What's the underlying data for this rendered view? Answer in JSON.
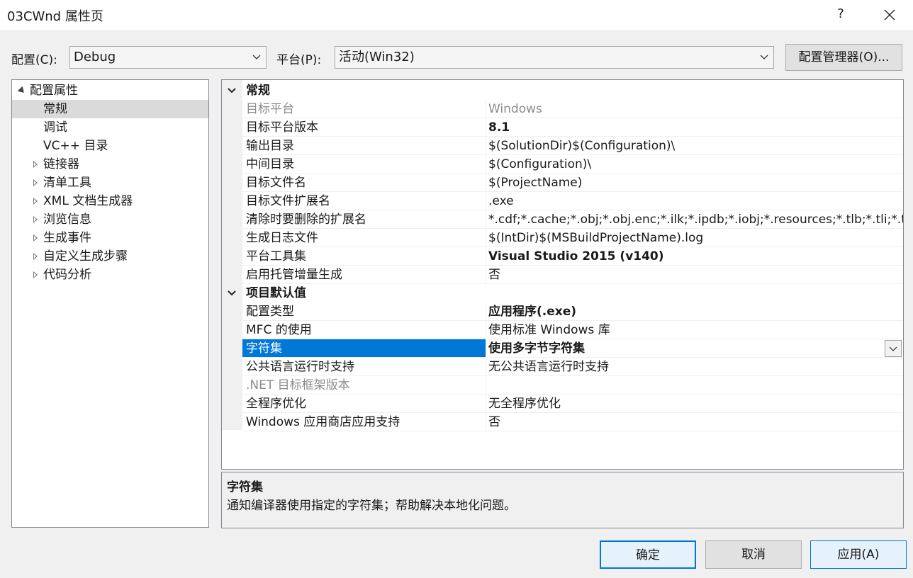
{
  "window": {
    "title": "03CWnd 属性页",
    "help_label": "?"
  },
  "toolbar": {
    "config_label": "配置(C):",
    "config_value": "Debug",
    "platform_label": "平台(P):",
    "platform_value": "活动(Win32)",
    "config_manager_label": "配置管理器(O)..."
  },
  "tree": {
    "root": "配置属性",
    "items": [
      {
        "label": "常规",
        "expandable": false,
        "selected": true
      },
      {
        "label": "调试",
        "expandable": false,
        "selected": false
      },
      {
        "label": "VC++ 目录",
        "expandable": false,
        "selected": false
      },
      {
        "label": "链接器",
        "expandable": true,
        "selected": false
      },
      {
        "label": "清单工具",
        "expandable": true,
        "selected": false
      },
      {
        "label": "XML 文档生成器",
        "expandable": true,
        "selected": false
      },
      {
        "label": "浏览信息",
        "expandable": true,
        "selected": false
      },
      {
        "label": "生成事件",
        "expandable": true,
        "selected": false
      },
      {
        "label": "自定义生成步骤",
        "expandable": true,
        "selected": false
      },
      {
        "label": "代码分析",
        "expandable": true,
        "selected": false
      }
    ]
  },
  "grid": {
    "sections": [
      {
        "title": "常规",
        "rows": [
          {
            "name": "目标平台",
            "value": "Windows",
            "disabled": true,
            "bold": false
          },
          {
            "name": "目标平台版本",
            "value": "8.1",
            "disabled": false,
            "bold": true
          },
          {
            "name": "输出目录",
            "value": "$(SolutionDir)$(Configuration)\\",
            "disabled": false,
            "bold": false
          },
          {
            "name": "中间目录",
            "value": "$(Configuration)\\",
            "disabled": false,
            "bold": false
          },
          {
            "name": "目标文件名",
            "value": "$(ProjectName)",
            "disabled": false,
            "bold": false
          },
          {
            "name": "目标文件扩展名",
            "value": ".exe",
            "disabled": false,
            "bold": false
          },
          {
            "name": "清除时要删除的扩展名",
            "value": "*.cdf;*.cache;*.obj;*.obj.enc;*.ilk;*.ipdb;*.iobj;*.resources;*.tlb;*.tli;*.tlh;*",
            "disabled": false,
            "bold": false
          },
          {
            "name": "生成日志文件",
            "value": "$(IntDir)$(MSBuildProjectName).log",
            "disabled": false,
            "bold": false
          },
          {
            "name": "平台工具集",
            "value": "Visual Studio 2015 (v140)",
            "disabled": false,
            "bold": true
          },
          {
            "name": "启用托管增量生成",
            "value": "否",
            "disabled": false,
            "bold": false
          }
        ]
      },
      {
        "title": "项目默认值",
        "rows": [
          {
            "name": "配置类型",
            "value": "应用程序(.exe)",
            "disabled": false,
            "bold": true
          },
          {
            "name": "MFC 的使用",
            "value": "使用标准 Windows 库",
            "disabled": false,
            "bold": false
          },
          {
            "name": "字符集",
            "value": "使用多字节字符集",
            "disabled": false,
            "bold": true,
            "selected": true
          },
          {
            "name": "公共语言运行时支持",
            "value": "无公共语言运行时支持",
            "disabled": false,
            "bold": false
          },
          {
            "name": ".NET 目标框架版本",
            "value": "",
            "disabled": true,
            "bold": false
          },
          {
            "name": "全程序优化",
            "value": "无全程序优化",
            "disabled": false,
            "bold": false
          },
          {
            "name": "Windows 应用商店应用支持",
            "value": "否",
            "disabled": false,
            "bold": false
          }
        ]
      }
    ]
  },
  "description": {
    "title": "字符集",
    "text": "通知编译器使用指定的字符集；帮助解决本地化问题。"
  },
  "buttons": {
    "ok": "确定",
    "cancel": "取消",
    "apply": "应用(A)"
  },
  "colors": {
    "selection": "#0078d7",
    "tree_selection": "#dadada",
    "background": "#f0f0f0"
  }
}
